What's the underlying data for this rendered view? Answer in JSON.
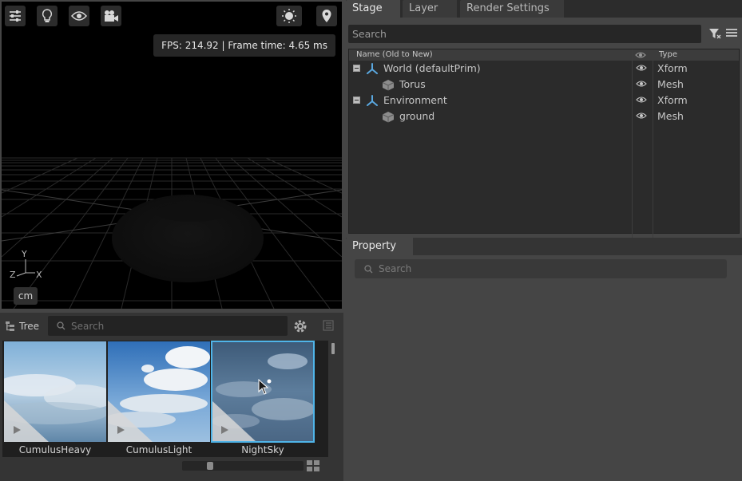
{
  "viewport": {
    "fps_text": "FPS: 214.92 | Frame time: 4.65 ms",
    "unit": "cm",
    "axis": {
      "y": "Y",
      "z": "Z",
      "x": "X"
    },
    "toolbar_icons": [
      "settings-sliders-icon",
      "lightbulb-icon",
      "eye-icon",
      "camera-icon"
    ],
    "toolbar_right_icons": [
      "sun-icon",
      "location-pin-icon"
    ]
  },
  "browser": {
    "tree_label": "Tree",
    "search_placeholder": "Search",
    "thumbnails": [
      {
        "label": "CumulusHeavy",
        "selected": false
      },
      {
        "label": "CumulusLight",
        "selected": false
      },
      {
        "label": "NightSky",
        "selected": true
      }
    ]
  },
  "stage": {
    "tabs": [
      "Stage",
      "Layer",
      "Render Settings"
    ],
    "active_tab": "Stage",
    "search_placeholder": "Search",
    "columns": {
      "name": "Name (Old to New)",
      "type": "Type"
    },
    "rows": [
      {
        "name": "World (defaultPrim)",
        "type": "Xform",
        "kind": "xform"
      },
      {
        "name": "Torus",
        "type": "Mesh",
        "kind": "mesh"
      },
      {
        "name": "Environment",
        "type": "Xform",
        "kind": "xform"
      },
      {
        "name": "ground",
        "type": "Mesh",
        "kind": "mesh"
      }
    ]
  },
  "property": {
    "tab": "Property",
    "search_placeholder": "Search"
  },
  "colors": {
    "accent": "#4fb4e8",
    "xform_icon": "#5aa8e0",
    "panel": "#454545"
  }
}
